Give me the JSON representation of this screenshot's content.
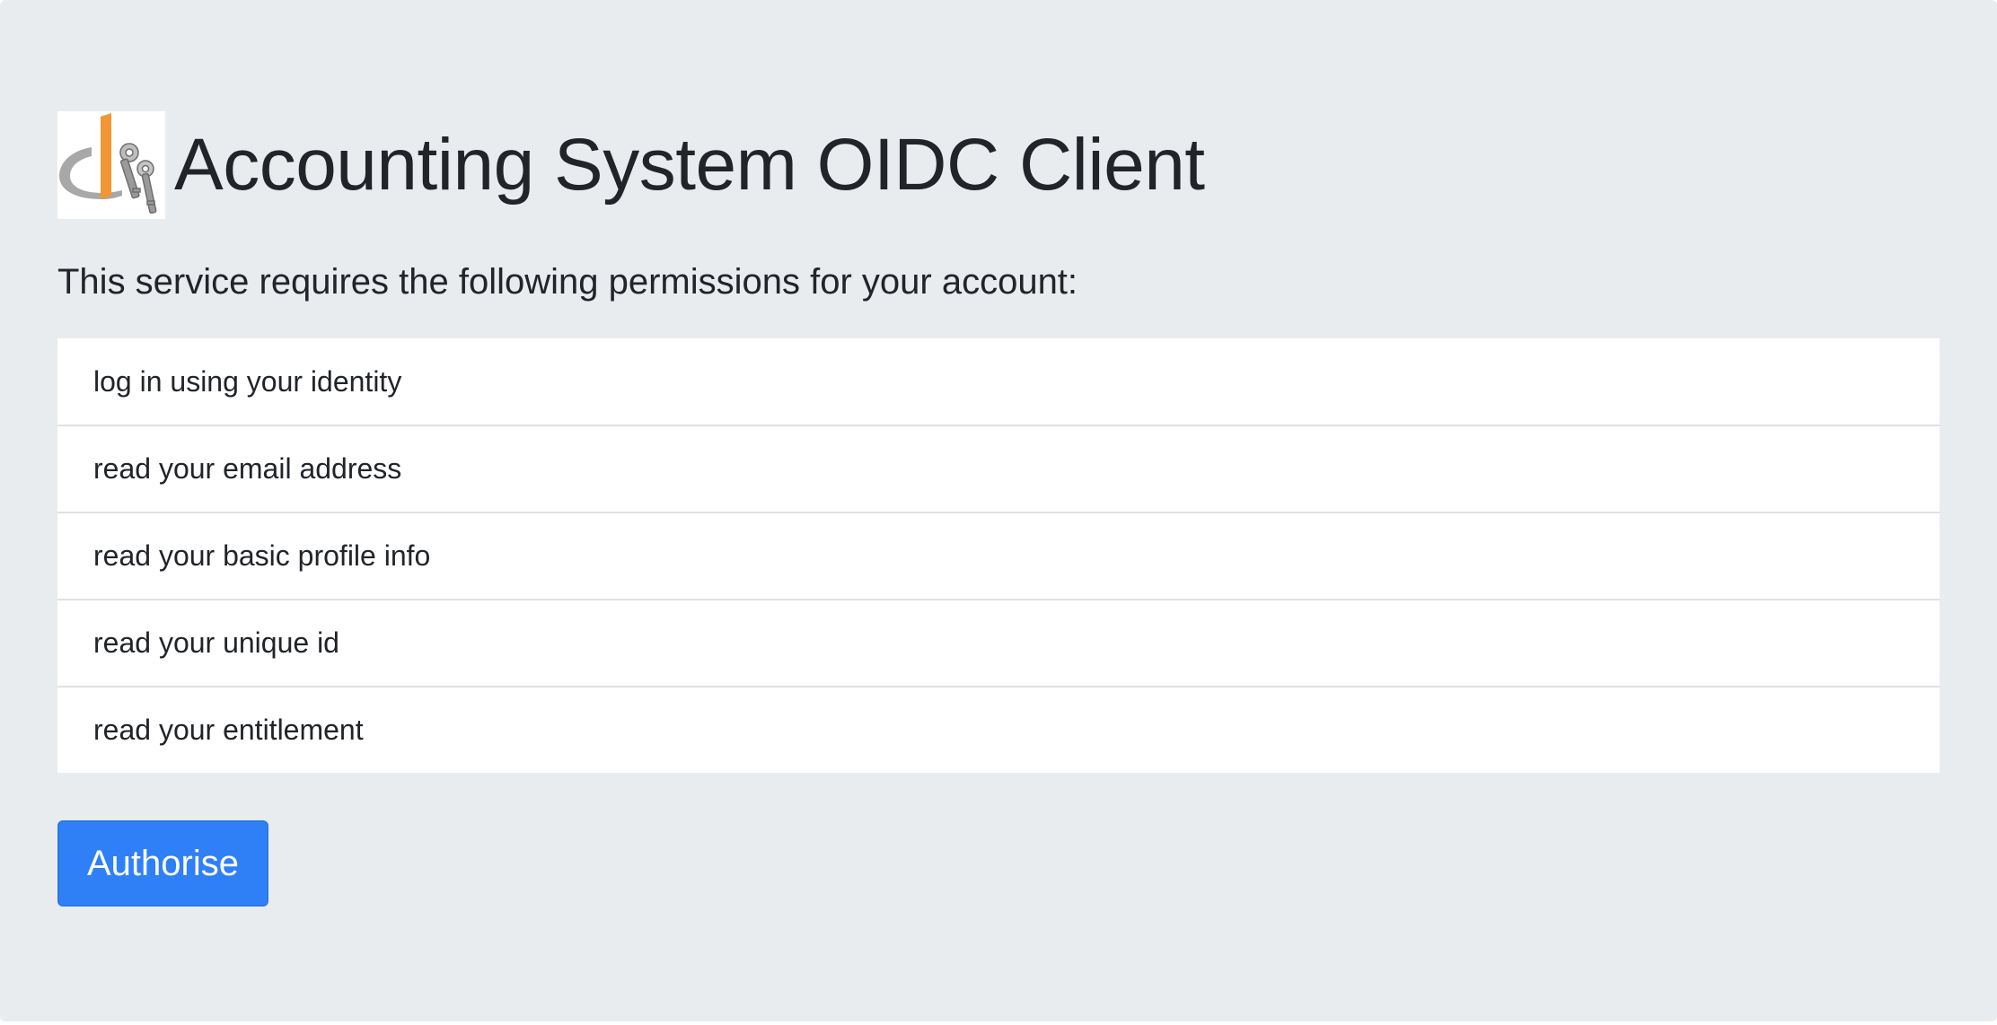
{
  "page": {
    "title": "Accounting System OIDC Client",
    "lead": "This service requires the following permissions for your account:"
  },
  "logo": {
    "icon": "openid-keys-logo"
  },
  "permissions": [
    "log in using your identity",
    "read your email address",
    "read your basic profile info",
    "read your unique id",
    "read your entitlement"
  ],
  "actions": {
    "authorise_label": "Authorise"
  },
  "colors": {
    "background": "#e9ecef",
    "primary_button": "#2f80f7",
    "logo_orange": "#f29633",
    "logo_grey": "#a8a8a8"
  }
}
